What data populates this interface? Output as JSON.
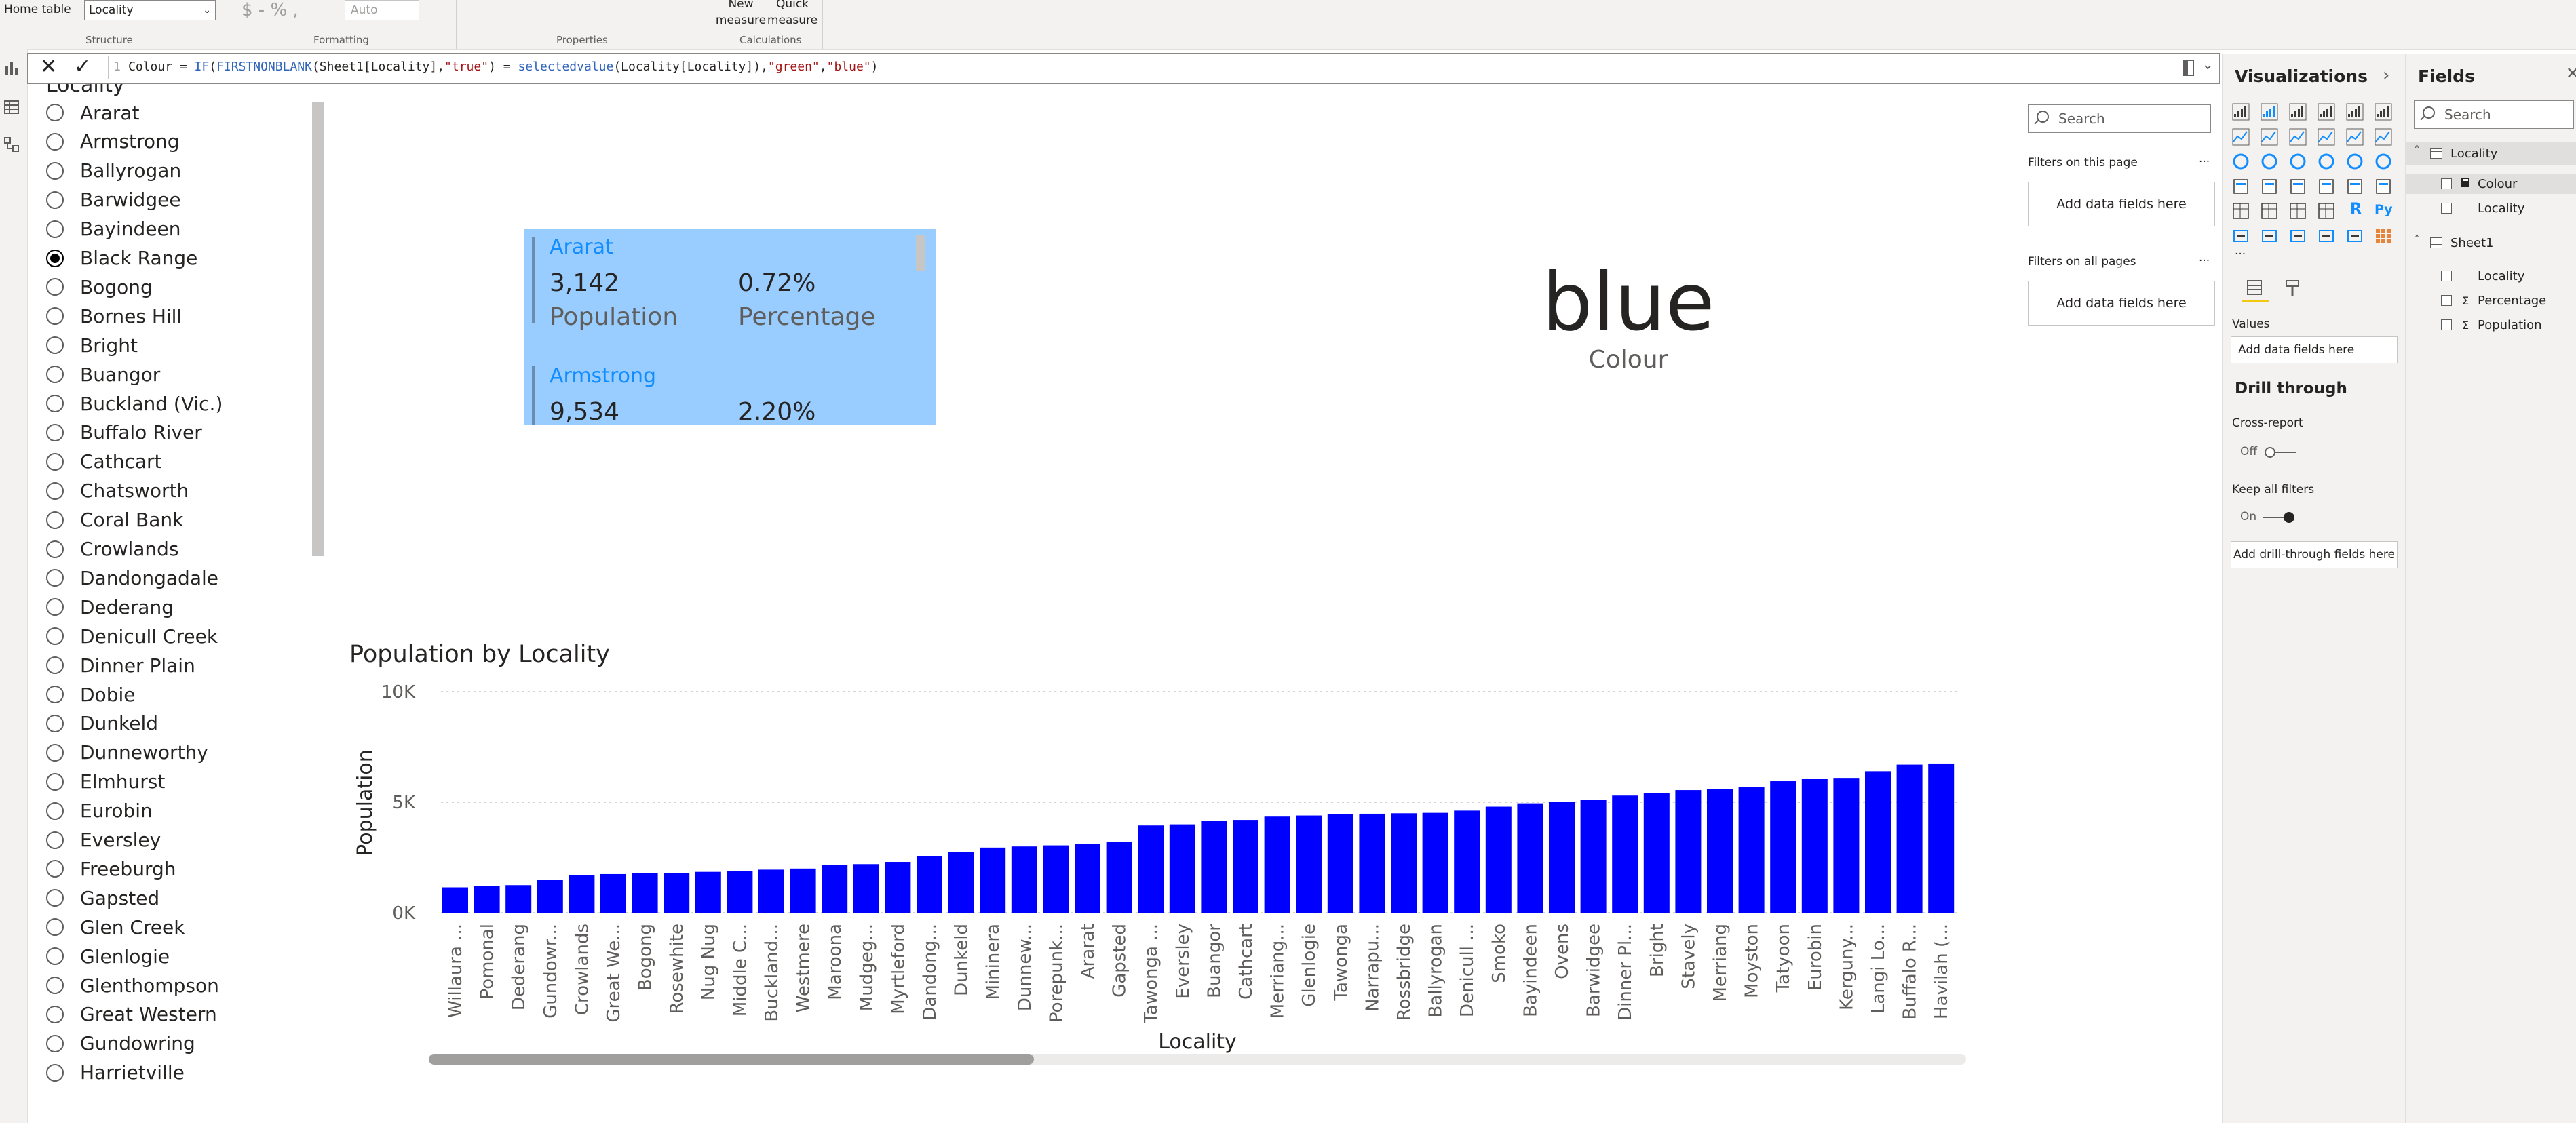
{
  "ribbon": {
    "home_table_label": "Home table",
    "home_table_value": "Locality",
    "format_symbols": "$ - % ,",
    "auto_label": "Auto",
    "new_measure": [
      "New",
      "measure"
    ],
    "quick_measure": [
      "Quick",
      "measure"
    ],
    "groups": [
      "Structure",
      "Formatting",
      "Properties",
      "Calculations"
    ]
  },
  "formula": {
    "line_no": "1",
    "text_parts": [
      {
        "t": "Colour = ",
        "c": "#252423"
      },
      {
        "t": "IF",
        "c": "#3165bb"
      },
      {
        "t": "(",
        "c": "#252423"
      },
      {
        "t": "FIRSTNONBLANK",
        "c": "#3165bb"
      },
      {
        "t": "(Sheet1[Locality],",
        "c": "#252423"
      },
      {
        "t": "\"true\"",
        "c": "#a31515"
      },
      {
        "t": ") = ",
        "c": "#252423"
      },
      {
        "t": "selectedvalue",
        "c": "#3165bb"
      },
      {
        "t": "(Locality[Locality]),",
        "c": "#252423"
      },
      {
        "t": "\"green\"",
        "c": "#a31515"
      },
      {
        "t": ",",
        "c": "#252423"
      },
      {
        "t": "\"blue\"",
        "c": "#a31515"
      },
      {
        "t": ")",
        "c": "#252423"
      }
    ]
  },
  "slicer": {
    "title": "Locality",
    "items": [
      "Ararat",
      "Armstrong",
      "Ballyrogan",
      "Barwidgee",
      "Bayindeen",
      "Black Range",
      "Bogong",
      "Bornes Hill",
      "Bright",
      "Buangor",
      "Buckland (Vic.)",
      "Buffalo River",
      "Cathcart",
      "Chatsworth",
      "Coral Bank",
      "Crowlands",
      "Dandongadale",
      "Dederang",
      "Denicull Creek",
      "Dinner Plain",
      "Dobie",
      "Dunkeld",
      "Dunneworthy",
      "Elmhurst",
      "Eurobin",
      "Eversley",
      "Freeburgh",
      "Gapsted",
      "Glen Creek",
      "Glenlogie",
      "Glenthompson",
      "Great Western",
      "Gundowring",
      "Harrietville"
    ],
    "selected_index": 5
  },
  "multirow_card": {
    "rows": [
      {
        "category": "Ararat",
        "value1": "3,142",
        "label1": "Population",
        "value2": "0.72%",
        "label2": "Percentage"
      },
      {
        "category": "Armstrong",
        "value1": "9,534",
        "label1": "Population",
        "value2": "2.20%",
        "label2": "Percentage"
      }
    ]
  },
  "card": {
    "value": "blue",
    "label": "Colour"
  },
  "chart_data": {
    "type": "bar",
    "title": "Population by Locality",
    "xlabel": "Locality",
    "ylabel": "Population",
    "ylim": [
      0,
      10000
    ],
    "yticks": [
      "0K",
      "5K",
      "10K"
    ],
    "color": "#0000ff",
    "categories": [
      "Willaura ...",
      "Pomonal",
      "Dederang",
      "Gundowr...",
      "Crowlands",
      "Great We...",
      "Bogong",
      "Rosewhite",
      "Nug Nug",
      "Middle C...",
      "Buckland...",
      "Westmere",
      "Maroona",
      "Mudgeg...",
      "Myrtleford",
      "Dandong...",
      "Dunkeld",
      "Mininera",
      "Dunnew...",
      "Porepunk...",
      "Ararat",
      "Gapsted",
      "Tawonga ...",
      "Eversley",
      "Buangor",
      "Cathcart",
      "Merriang...",
      "Glenlogie",
      "Tawonga",
      "Narrapu...",
      "Rossbridge",
      "Ballyrogan",
      "Denicull ...",
      "Smoko",
      "Bayindeen",
      "Ovens",
      "Barwidgee",
      "Dinner Pl...",
      "Bright",
      "Stavely",
      "Merriang",
      "Moyston",
      "Tatyoon",
      "Eurobin",
      "Kerguny...",
      "Langi Lo...",
      "Buffalo R...",
      "Havilah (..."
    ],
    "values": [
      1150,
      1200,
      1250,
      1500,
      1700,
      1750,
      1780,
      1800,
      1850,
      1900,
      1950,
      2000,
      2150,
      2200,
      2300,
      2550,
      2750,
      2950,
      3000,
      3050,
      3100,
      3200,
      3950,
      4000,
      4150,
      4200,
      4350,
      4400,
      4450,
      4480,
      4500,
      4520,
      4620,
      4800,
      4950,
      5000,
      5100,
      5300,
      5400,
      5550,
      5600,
      5700,
      5950,
      6050,
      6100,
      6400,
      6700,
      6750
    ]
  },
  "filters_pane": {
    "search_placeholder": "Search",
    "on_this_page": "Filters on this page",
    "on_all_pages": "Filters on all pages",
    "add_fields": "Add data fields here",
    "more": "..."
  },
  "visualizations_pane": {
    "title": "Visualizations",
    "values_label": "Values",
    "add_fields": "Add data fields here",
    "drill_through": "Drill through",
    "cross_report": "Cross-report",
    "cross_report_state": "Off",
    "keep_all_filters": "Keep all filters",
    "keep_all_filters_state": "On",
    "add_drill": "Add drill-through fields here",
    "more": "...",
    "r_label": "R",
    "py_label": "Py"
  },
  "fields_pane": {
    "title": "Fields",
    "search_placeholder": "Search",
    "tables": [
      {
        "name": "Locality",
        "fields": [
          {
            "name": "Colour",
            "icon": "calculator"
          },
          {
            "name": "Locality",
            "icon": ""
          }
        ]
      },
      {
        "name": "Sheet1",
        "fields": [
          {
            "name": "Locality",
            "icon": ""
          },
          {
            "name": "Percentage",
            "icon": "Σ"
          },
          {
            "name": "Population",
            "icon": "Σ"
          }
        ]
      }
    ]
  }
}
